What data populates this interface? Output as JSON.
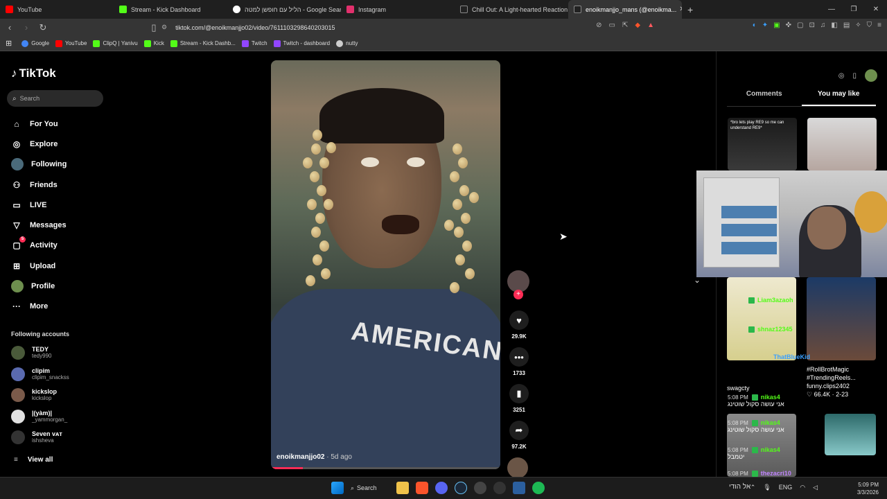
{
  "browser": {
    "tabs": [
      {
        "label": "YouTube",
        "color": "#ff0000",
        "active": false
      },
      {
        "label": "Stream - Kick Dashboard",
        "color": "#53fc18",
        "active": false
      },
      {
        "label": "הליל עם חופשן למטה - Google Search",
        "color": "#4285f4",
        "active": false
      },
      {
        "label": "Instagram",
        "color": "#e1306c",
        "active": false
      },
      {
        "label": "Chill Out: A Light-hearted Reaction to...",
        "color": "#222222",
        "active": false
      },
      {
        "label": "enoikmanjjo_mans (@enoikma...",
        "color": "#222222",
        "active": true
      }
    ],
    "url": "tiktok.com/@enoikmanjjo02/video/7611103298640203015",
    "bookmarks": [
      {
        "label": "Google",
        "color": "#4285f4"
      },
      {
        "label": "YouTube",
        "color": "#ff0000"
      },
      {
        "label": "ClipQ | Yanivu",
        "color": "#53fc18"
      },
      {
        "label": "Kick",
        "color": "#53fc18"
      },
      {
        "label": "Stream - Kick Dashb...",
        "color": "#53fc18"
      },
      {
        "label": "Twitch",
        "color": "#9146ff"
      },
      {
        "label": "Twitch - dashboard",
        "color": "#9146ff"
      },
      {
        "label": "nutty",
        "color": "#cccccc"
      }
    ]
  },
  "tiktok": {
    "brand": "TikTok",
    "search_placeholder": "Search",
    "nav": [
      {
        "label": "For You",
        "icon": "home-icon"
      },
      {
        "label": "Explore",
        "icon": "compass-icon"
      },
      {
        "label": "Following",
        "icon": "following-avatar-icon"
      },
      {
        "label": "Friends",
        "icon": "friends-icon"
      },
      {
        "label": "LIVE",
        "icon": "live-icon"
      },
      {
        "label": "Messages",
        "icon": "messages-icon"
      },
      {
        "label": "Activity",
        "icon": "activity-icon",
        "badge": "5"
      },
      {
        "label": "Upload",
        "icon": "upload-icon"
      },
      {
        "label": "Profile",
        "icon": "profile-avatar-icon"
      },
      {
        "label": "More",
        "icon": "more-icon"
      }
    ],
    "following_title": "Following accounts",
    "following": [
      {
        "name": "TEDY",
        "handle": "tedy990"
      },
      {
        "name": "clipim",
        "handle": "clipim_snackss"
      },
      {
        "name": "kickslop",
        "handle": "kickslop"
      },
      {
        "name": "|(yàm)|",
        "handle": "_yammorgan_"
      },
      {
        "name": "Seven ᴠᴀᴛ",
        "handle": "ishsheva"
      }
    ],
    "view_all": "View all",
    "video": {
      "author": "enoikmanjjo02",
      "age": " · 5d ago",
      "shirt_text": "AMERICAN"
    },
    "actions": {
      "likes": "29.9K",
      "comments": "1733",
      "saves": "3251",
      "shares": "97.2K"
    },
    "right_tabs": [
      "Comments",
      "You may like"
    ],
    "thumb_caption": "*bro lets play RE9 so me can understand RE9*",
    "cards": [
      {
        "meta1": "swagcty",
        "meta2": "",
        "stats": ""
      },
      {
        "meta1": "#RollBrotMagic",
        "meta2": "#TrendingReels...",
        "account": "funny.clips2402",
        "stats": "♡ 66.4K · 2-23"
      }
    ]
  },
  "chat": [
    {
      "time": "",
      "user": "Liam3azaoh",
      "msg": ""
    },
    {
      "time": "",
      "user": "shnaz12345",
      "msg": ""
    },
    {
      "time": "",
      "user": "ThatBlueKid",
      "msg": ""
    },
    {
      "time": "5:08 PM",
      "user": "nikas4",
      "msg": "אני עושה סקול שוטינג"
    },
    {
      "time": "5:08 PM",
      "user": "nikas4",
      "msg": "אני עושה סקול שוטינג"
    },
    {
      "time": "5:08 PM",
      "user": "nikas4",
      "msg": "יטמבל"
    },
    {
      "time": "5:08 PM",
      "user": "thezacri10",
      "msg": ""
    }
  ],
  "taskbar": {
    "weather": "אל הודי",
    "search": "Search",
    "lang": "ENG",
    "time": "5:09 PM",
    "date": "3/3/2026"
  }
}
